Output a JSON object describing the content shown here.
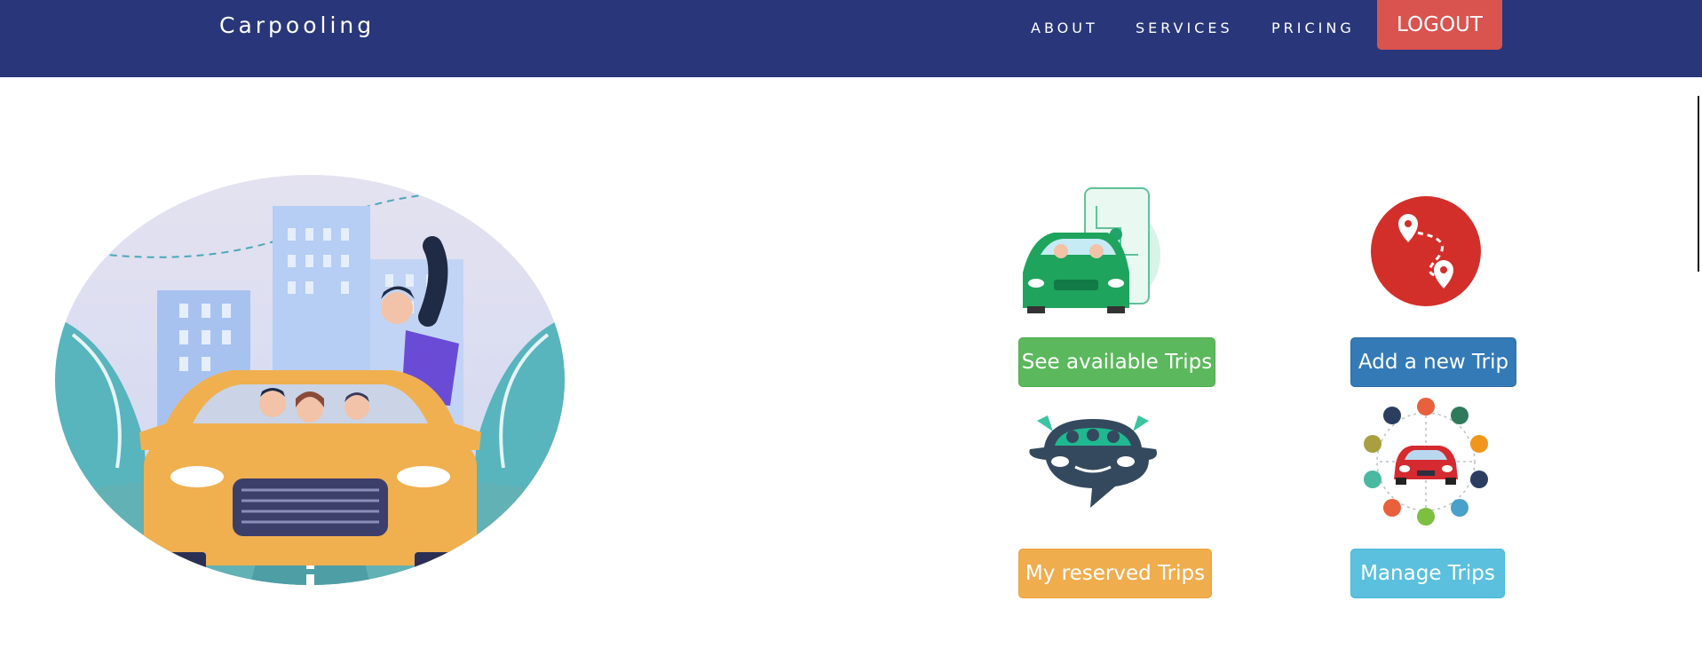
{
  "navbar": {
    "brand": "Carpooling",
    "links": [
      "ABOUT",
      "SERVICES",
      "PRICING"
    ],
    "logout": "LOGOUT"
  },
  "actions": {
    "see_trips": "See available Trips",
    "add_trip": "Add a new Trip",
    "reserved_trips": "My reserved Trips",
    "manage_trips": "Manage Trips"
  },
  "colors": {
    "navbar": "#29377a",
    "logout": "#d9534f",
    "success": "#5cb85c",
    "primary": "#337ab7",
    "warning": "#f0ad4e",
    "info": "#5bc0de"
  },
  "icons": {
    "hero": "carpool-friends-car-illustration",
    "see_trips": "car-navigation-phone-illustration",
    "add_trip": "route-pins-icon",
    "reserved_trips": "car-speech-bubble-icon",
    "manage_trips": "car-services-circle-icon"
  }
}
